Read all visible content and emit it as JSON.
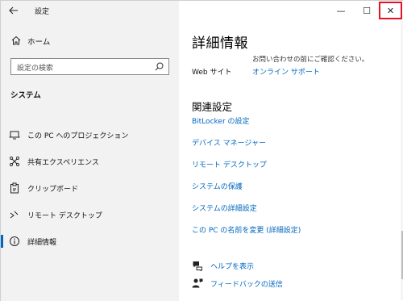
{
  "window": {
    "title": "設定",
    "back_icon": "arrow-left-icon",
    "minimize_glyph": "—",
    "maximize_glyph": "☐",
    "close_glyph": "✕",
    "close_highlight_color": "#e81123"
  },
  "sidebar": {
    "home_label": "ホーム",
    "search_placeholder": "設定の検索",
    "section_label": "システム",
    "items": [
      {
        "label": "この PC へのプロジェクション",
        "icon": "projector-icon"
      },
      {
        "label": "共有エクスペリエンス",
        "icon": "shared-experiences-icon"
      },
      {
        "label": "クリップボード",
        "icon": "clipboard-icon"
      },
      {
        "label": "リモート デスクトップ",
        "icon": "remote-desktop-icon"
      },
      {
        "label": "詳細情報",
        "icon": "info-icon",
        "selected": true
      }
    ]
  },
  "main": {
    "title": "詳細情報",
    "cut_text": "お問い合わせの前にご確認ください。",
    "web_label": "Web サイト",
    "web_link": "オンライン サポート",
    "related_heading": "関連設定",
    "related_links": [
      "BitLocker の設定",
      "デバイス マネージャー",
      "リモート デスクトップ",
      "システムの保護",
      "システムの詳細設定",
      "この PC の名前を変更 (詳細設定)"
    ],
    "help_label": "ヘルプを表示",
    "feedback_label": "フィードバックの送信"
  },
  "colors": {
    "accent": "#0067c0",
    "sidebar_bg": "#f2f2f2"
  }
}
